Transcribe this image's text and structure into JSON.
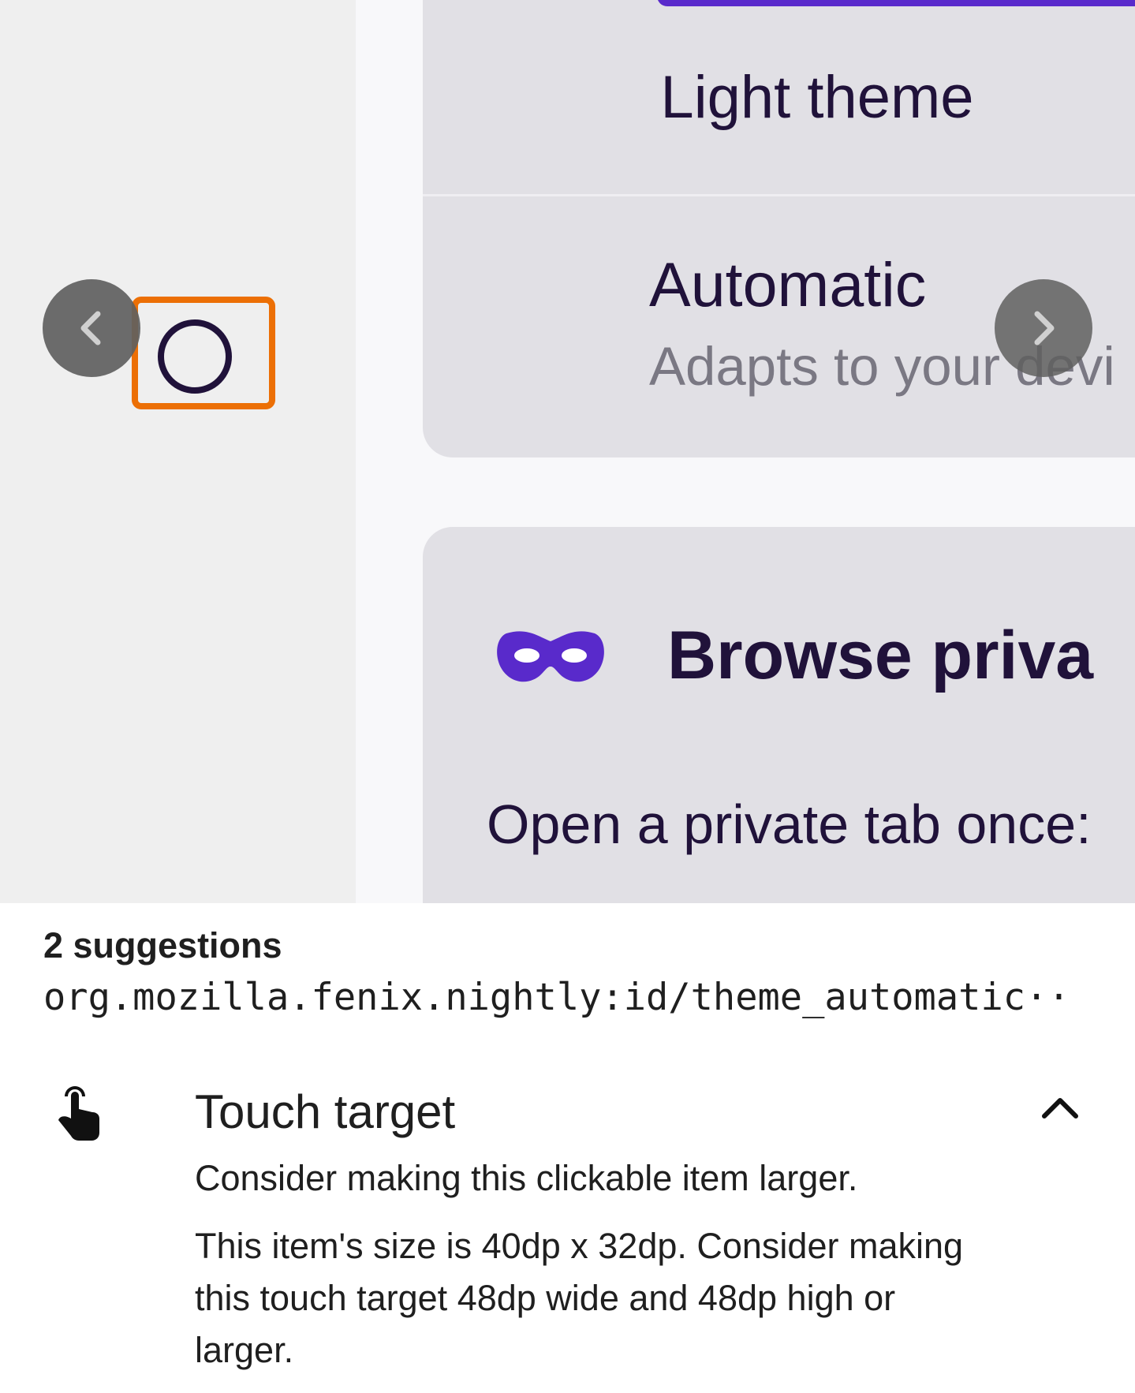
{
  "preview": {
    "light_theme_label": "Light theme",
    "automatic_title": "Automatic",
    "automatic_subtitle": "Adapts to your devi",
    "browse_private_title": "Browse priva",
    "open_private_text": "Open a private tab once:",
    "icons": {
      "prev": "chevron-left-icon",
      "next": "chevron-right-icon",
      "mask": "private-mask-icon",
      "radio": "radio-unselected-icon"
    },
    "colors": {
      "highlight": "#ec6f05",
      "accent": "#592acb",
      "text_dark": "#20123a"
    }
  },
  "panel": {
    "suggestion_count": "2 suggestions",
    "resource_id": "org.mozilla.fenix.nightly:id/theme_automatic··",
    "suggestion": {
      "icon": "touch-app-icon",
      "title": "Touch target",
      "description": "Consider making this clickable item larger.",
      "detail": "This item's size is 40dp x 32dp. Consider making this touch target 48dp wide and 48dp high or larger."
    }
  }
}
